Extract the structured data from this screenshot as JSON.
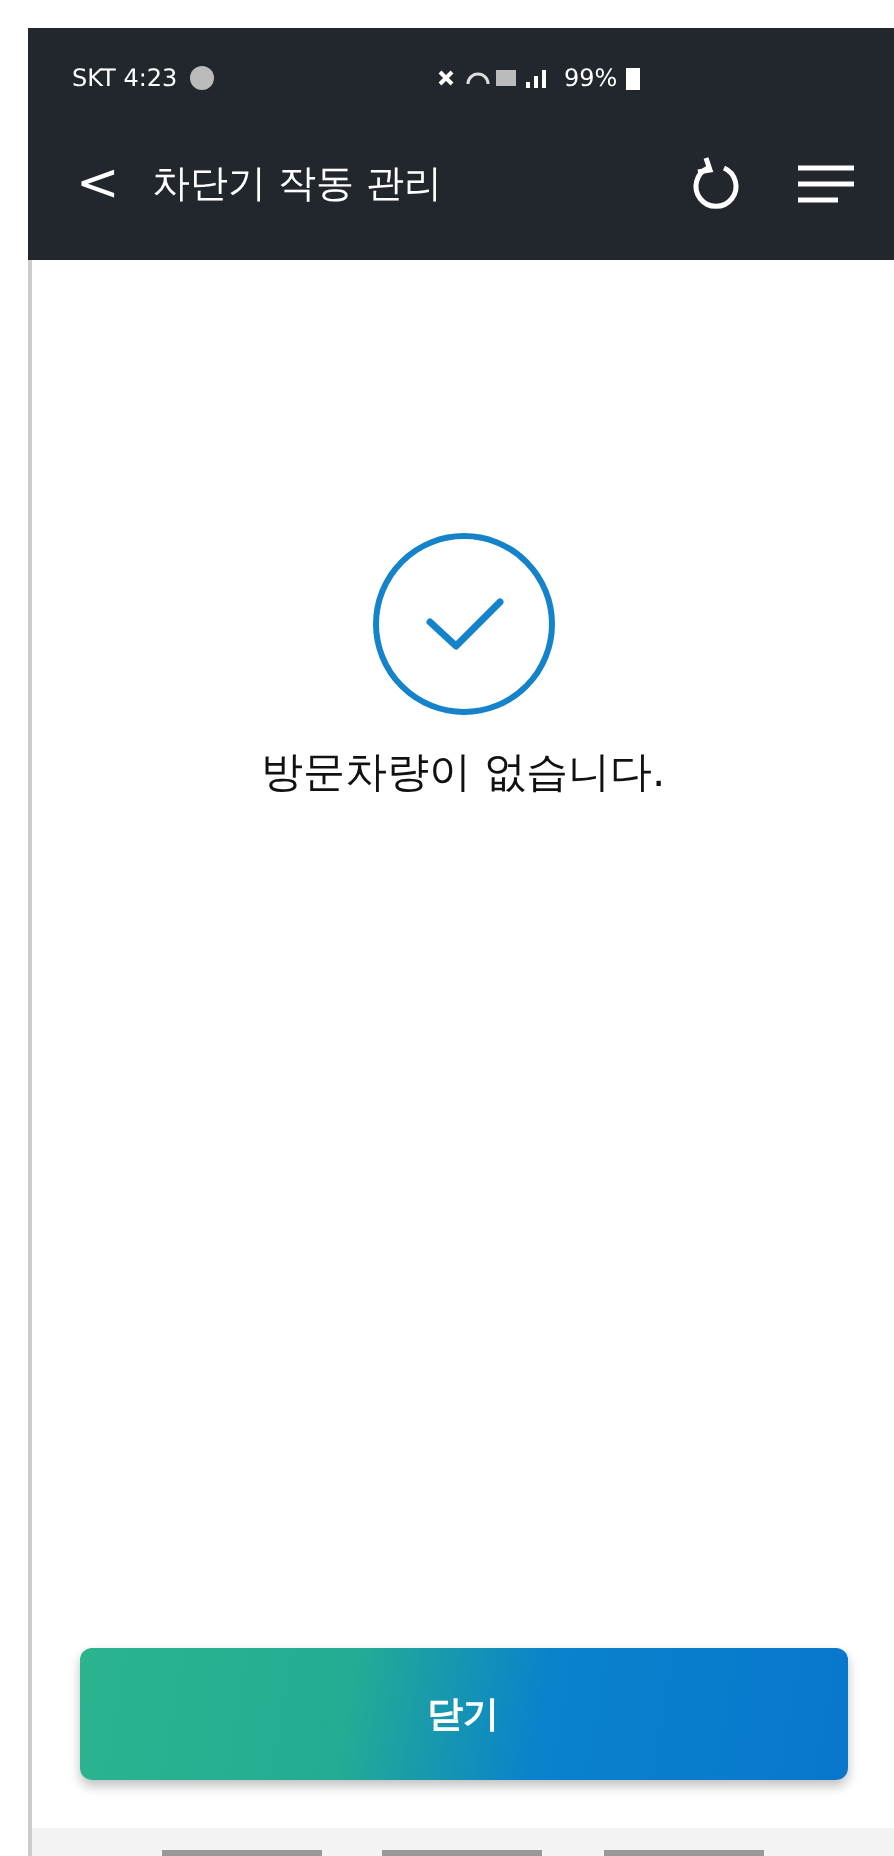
{
  "status_bar": {
    "carrier_time": "SKT 4:23",
    "battery": "99%"
  },
  "header": {
    "back": "<",
    "title": "차단기 작동 관리"
  },
  "message": "방문차량이 없습니다.",
  "close_button": "닫기"
}
